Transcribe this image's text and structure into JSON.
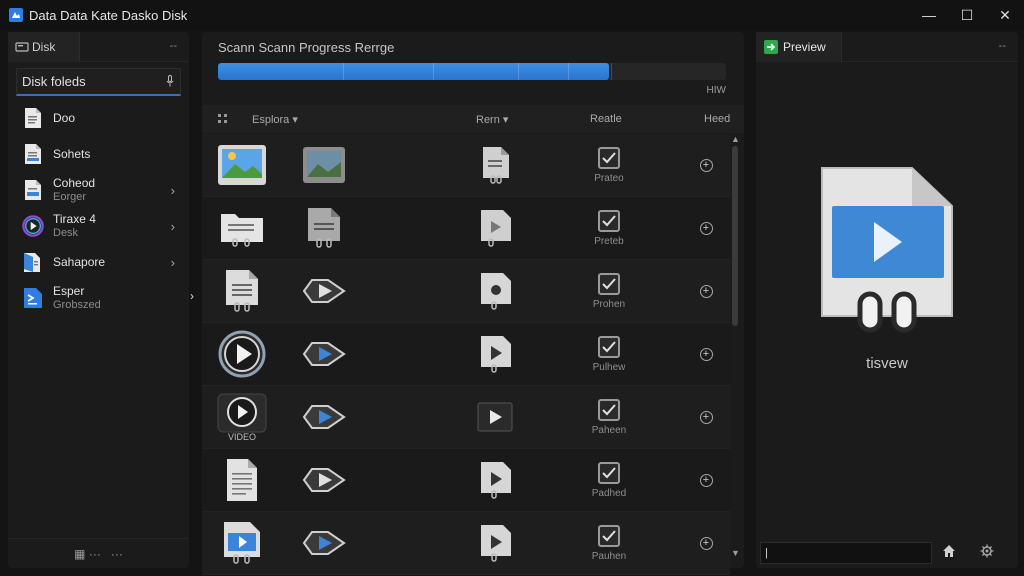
{
  "window": {
    "title": "Data Data Kate Dasko Disk",
    "minimize": "—",
    "maximize": "☐",
    "close": "✕"
  },
  "left_panel": {
    "tab_label": "Disk",
    "tab_menu": "--",
    "header": "Disk foleds",
    "items": [
      {
        "label": "Doo",
        "sub": "",
        "icon": "document-icon",
        "chevron": false
      },
      {
        "label": "Sohets",
        "sub": "",
        "icon": "document-icon",
        "chevron": false
      },
      {
        "label": "Coheod",
        "sub": "Eorger",
        "icon": "document-icon",
        "chevron": true
      },
      {
        "label": "Tiraxe 4",
        "sub": "Desk",
        "icon": "media-ring-icon",
        "chevron": true
      },
      {
        "label": "Sahapore",
        "sub": "",
        "icon": "blue-document-icon",
        "chevron": true
      },
      {
        "label": "Esper",
        "sub": "Grobszed",
        "icon": "terminal-icon",
        "chevron": false
      }
    ],
    "footer": [
      "▦ ···",
      "···"
    ]
  },
  "splitter_arrow": "›",
  "scan": {
    "title": "Scann Scann Progress Rerrge",
    "progress": 0.77,
    "rate": "HIW",
    "columns": {
      "explore": "Esplora ▾",
      "item": "Rern ▾",
      "status": "Reatle",
      "head": "Heed"
    },
    "rows": [
      {
        "thumb": "image-thumb",
        "type": "image-thumb-2",
        "file": "document-file",
        "status": "Prateo"
      },
      {
        "thumb": "document-folder",
        "type": "document-file-2",
        "file": "video-file",
        "status": "Preteb"
      },
      {
        "thumb": "document-file",
        "type": "play-arrow",
        "file": "video-file-2",
        "status": "Prohen"
      },
      {
        "thumb": "play-circle",
        "type": "play-arrow-blue",
        "file": "video-file-3",
        "status": "Pulhew"
      },
      {
        "thumb": "video-badge",
        "thumb_text": "VIDEO",
        "type": "play-arrow-blue",
        "file": "video-file-dark",
        "status": "Paheen"
      },
      {
        "thumb": "text-document",
        "type": "play-arrow",
        "file": "video-file-3",
        "status": "Padhed"
      },
      {
        "thumb": "video-doc",
        "type": "play-arrow-blue",
        "file": "video-file-3",
        "status": "Pauhen"
      }
    ]
  },
  "preview": {
    "tab_label": "Preview",
    "tab_menu": "--",
    "caption": "tisvew",
    "input_value": "|"
  },
  "colors": {
    "accent": "#2f7de0",
    "progress": "#3a8be4",
    "preview_tab": "#2ea84b",
    "panel": "#1b1b1b"
  }
}
